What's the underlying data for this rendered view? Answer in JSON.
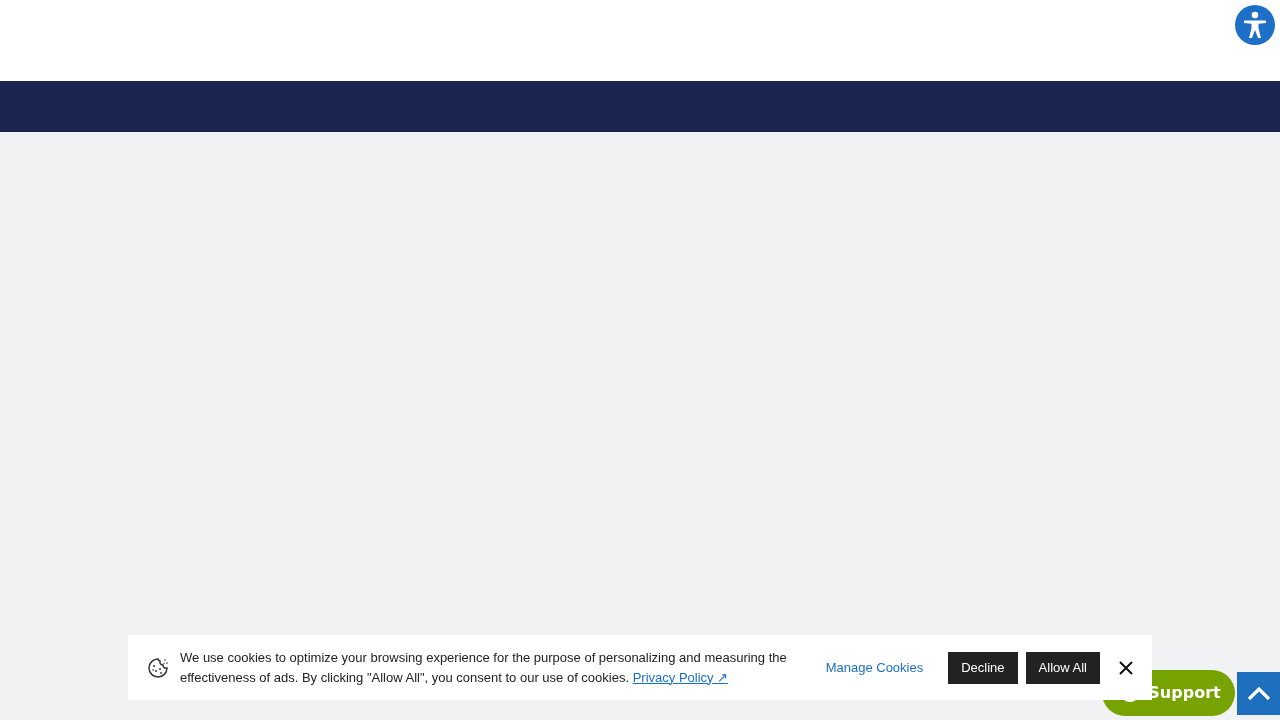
{
  "cookie_banner": {
    "message": "We use cookies to optimize your browsing experience for the purpose of personalizing and measuring the effectiveness of ads. By clicking \"Allow All\", you consent to our use of cookies.",
    "privacy_link": "Privacy Policy ↗",
    "manage_link": "Manage Cookies",
    "decline_button": "Decline",
    "allow_button": "Allow All"
  },
  "support_button": {
    "label": "Support"
  }
}
